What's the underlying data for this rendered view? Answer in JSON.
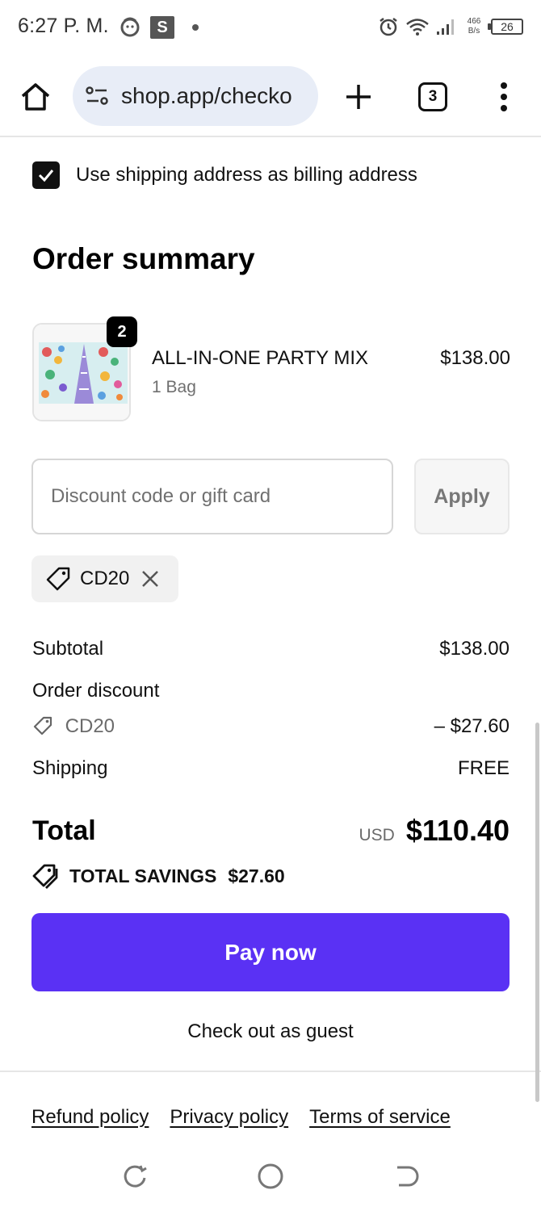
{
  "status_bar": {
    "time": "6:27 P. M.",
    "app_badge": "S",
    "net_speed_value": "466",
    "net_speed_unit": "B/s",
    "battery": "26"
  },
  "browser": {
    "url": "shop.app/checko",
    "tab_count": "3"
  },
  "checkout": {
    "billing_checkbox_label": "Use shipping address as billing address",
    "billing_checked": true,
    "section_title": "Order summary",
    "product": {
      "name": "ALL-IN-ONE PARTY MIX",
      "variant": "1 Bag",
      "price": "$138.00",
      "quantity": "2"
    },
    "discount": {
      "placeholder": "Discount code or gift card",
      "apply_label": "Apply",
      "applied_code": "CD20"
    },
    "summary": {
      "subtotal_label": "Subtotal",
      "subtotal_value": "$138.00",
      "order_discount_label": "Order discount",
      "discount_code": "CD20",
      "discount_value": "– $27.60",
      "shipping_label": "Shipping",
      "shipping_value": "FREE",
      "total_label": "Total",
      "total_currency": "USD",
      "total_value": "$110.40",
      "savings_label": "TOTAL SAVINGS",
      "savings_value": "$27.60"
    },
    "pay_button": "Pay now",
    "guest_link": "Check out as guest",
    "footer_links": [
      "Refund policy",
      "Privacy policy",
      "Terms of service"
    ]
  },
  "colors": {
    "accent": "#5a31f4",
    "url_pill": "#e8edf7"
  },
  "icons": {
    "home": "home-icon",
    "tune": "tune-icon",
    "plus": "plus-icon",
    "menu": "more-vert-icon",
    "tag": "tag-icon",
    "close": "close-icon",
    "savings": "savings-tag-icon"
  }
}
